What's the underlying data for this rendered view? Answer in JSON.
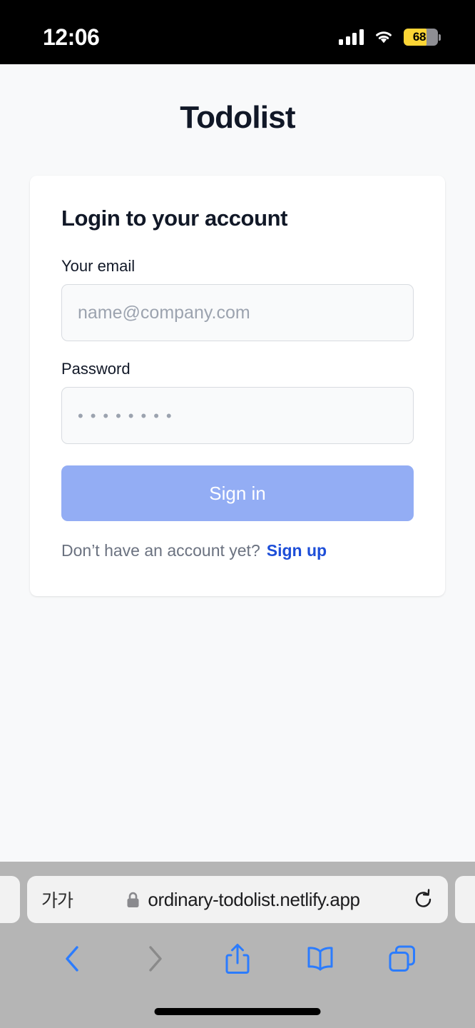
{
  "status_bar": {
    "time": "12:06",
    "cellular_icon": "cellular-bars-icon",
    "wifi_icon": "wifi-icon",
    "battery_level": "68",
    "battery_color": "#fcd535",
    "battery_icon": "battery-icon"
  },
  "page": {
    "background_color": "#f8f9fa",
    "app_title": "Todolist",
    "card": {
      "heading": "Login to your account",
      "email": {
        "label": "Your email",
        "placeholder": "name@company.com",
        "value": ""
      },
      "password": {
        "label": "Password",
        "placeholder": "••••••••",
        "value": ""
      },
      "submit_label": "Sign in",
      "submit_color": "#93adf4",
      "footer_text": "Don’t have an account yet?",
      "footer_link": "Sign up",
      "footer_link_color": "#1d4ed8"
    }
  },
  "browser": {
    "text_size_button": "가가",
    "lock_icon": "lock-icon",
    "url": "ordinary-todolist.netlify.app",
    "reload_icon": "reload-icon",
    "toolbar": {
      "back_icon": "chevron-left-icon",
      "forward_icon": "chevron-right-icon",
      "share_icon": "share-icon",
      "bookmarks_icon": "book-icon",
      "tabs_icon": "tabs-icon",
      "active_color": "#2b7cff",
      "disabled_color": "#8a8a8a"
    }
  }
}
